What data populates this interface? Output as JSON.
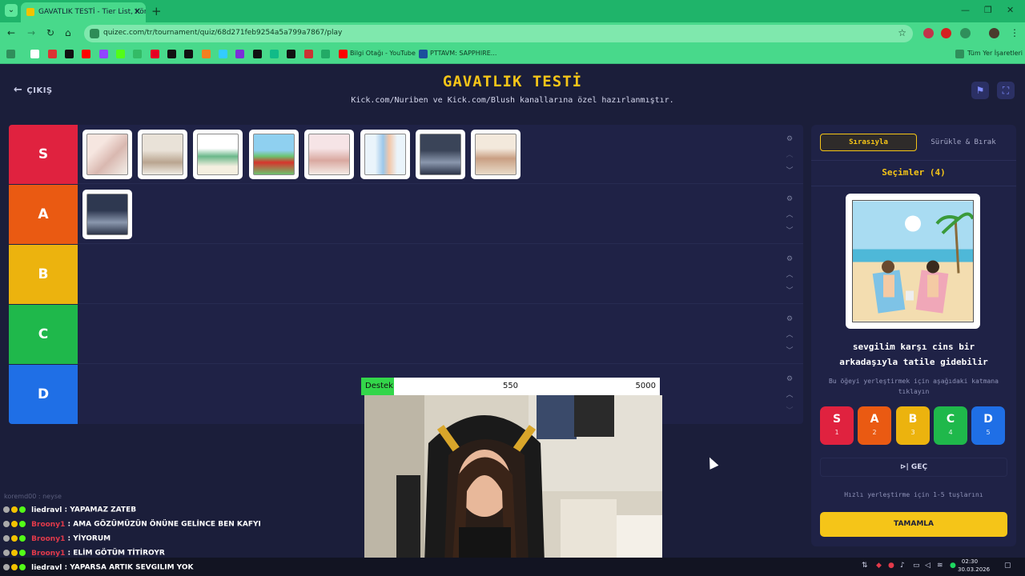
{
  "browser": {
    "tab_title": "GAVATLIK TESTİ - Tier List, Kör",
    "new_tab_label": "+",
    "url": "quizec.com/tr/tournament/quiz/68d271feb9254a5a799a7867/play",
    "bookmarks": [
      "Bilgi Otağı - YouTube",
      "PTTAVM: SAPPHIRE..."
    ],
    "all_bookmarks_label": "Tüm Yer İşaretleri"
  },
  "page": {
    "exit_label": "ÇIKIŞ",
    "title": "GAVATLIK TESTİ",
    "subtitle": "Kick.com/Nuriben ve Kick.com/Blush kanallarına özel hazırlanmıştır."
  },
  "tiers": [
    {
      "label": "S",
      "color": "#e0223f",
      "items": [
        "bed-scene",
        "group-chat-scene",
        "document-scene",
        "car-scene",
        "hearts-couple-scene",
        "phone-scene",
        "night-talk-scene",
        "family-scene"
      ]
    },
    {
      "label": "A",
      "color": "#ea5a12",
      "items": [
        "night-talk-scene-2"
      ]
    },
    {
      "label": "B",
      "color": "#ecb30e",
      "items": []
    },
    {
      "label": "C",
      "color": "#1fb84b",
      "items": []
    },
    {
      "label": "D",
      "color": "#1f6fe6",
      "items": []
    }
  ],
  "panel": {
    "mode_sequential": "Sırasıyla",
    "mode_drag": "Sürükle & Bırak",
    "choices_label": "Seçimler (4)",
    "question": "sevgilim karşı cins bir arkadaşıyla tatile gidebilir",
    "hint": "Bu öğeyi yerleştirmek için aşağıdaki katmana tıklayın",
    "tier_buttons": [
      {
        "label": "S",
        "key": "1",
        "color": "#e0223f"
      },
      {
        "label": "A",
        "key": "2",
        "color": "#ea5a12"
      },
      {
        "label": "B",
        "key": "3",
        "color": "#ecb30e"
      },
      {
        "label": "C",
        "key": "4",
        "color": "#1fb84b"
      },
      {
        "label": "D",
        "key": "5",
        "color": "#1f6fe6"
      }
    ],
    "skip_label": "GEÇ",
    "note": "Hızlı yerleştirme için 1-5 tuşlarını",
    "complete_label": "TAMAMLA"
  },
  "stream": {
    "goal_label": "Destek",
    "goal_current": "550",
    "goal_max": "5000",
    "goal_progress": 0.11,
    "chat_ghost": "koremd00 : neyse",
    "chat": [
      {
        "user": "liedravl",
        "text": ": YAPAMAZ ZATEB",
        "color": "#ffffff"
      },
      {
        "user": "Broony1",
        "text": ": AMA GÖZÜMÜZÜN ÖNÜNE GELİNCE BEN KAFYI",
        "color": "#e23a4a"
      },
      {
        "user": "Broony1",
        "text": ": YİYORUM",
        "color": "#e23a4a"
      },
      {
        "user": "Broony1",
        "text": ": ELİM GÖTÜM TİTİROYR",
        "color": "#e23a4a"
      },
      {
        "user": "liedravl",
        "text": ": YAPARSA ARTIK SEVGILIM YOK",
        "color": "#ffffff"
      }
    ]
  },
  "taskbar": {
    "time": "02:30",
    "date": "30.03.2026"
  }
}
